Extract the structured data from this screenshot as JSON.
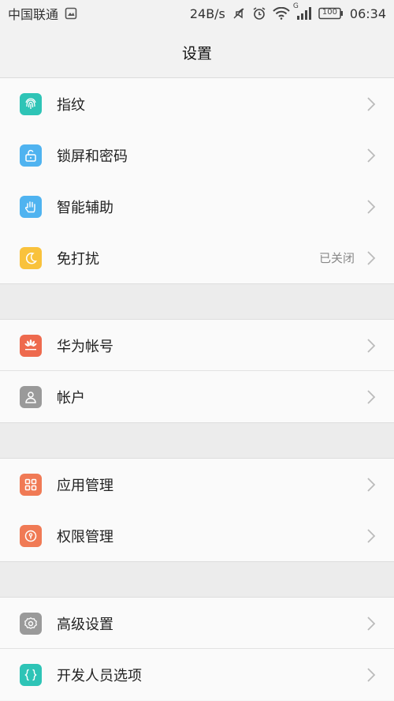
{
  "status_bar": {
    "carrier": "中国联通",
    "net_speed": "24B/s",
    "battery": "100",
    "time": "06:34",
    "signal_type": "G"
  },
  "title": "设置",
  "groups": [
    {
      "items": [
        {
          "label": "指纹",
          "icon": "fingerprint-icon",
          "color": "#2ec4b6"
        },
        {
          "label": "锁屏和密码",
          "icon": "lock-icon",
          "color": "#4fb3f0"
        },
        {
          "label": "智能辅助",
          "icon": "hand-icon",
          "color": "#4fb3f0"
        },
        {
          "label": "免打扰",
          "icon": "moon-icon",
          "color": "#f9c23c",
          "value": "已关闭"
        }
      ]
    },
    {
      "items": [
        {
          "label": "华为帐号",
          "icon": "huawei-icon",
          "color": "#ee6a4e"
        },
        {
          "label": "帐户",
          "icon": "person-icon",
          "color": "#9a9a9a"
        }
      ]
    },
    {
      "items": [
        {
          "label": "应用管理",
          "icon": "apps-grid-icon",
          "color": "#f07a55"
        },
        {
          "label": "权限管理",
          "icon": "keyhole-icon",
          "color": "#f07a55"
        }
      ]
    },
    {
      "items": [
        {
          "label": "高级设置",
          "icon": "gear-icon",
          "color": "#9a9a9a"
        },
        {
          "label": "开发人员选项",
          "icon": "braces-icon",
          "color": "#2ec4b6"
        }
      ]
    }
  ]
}
